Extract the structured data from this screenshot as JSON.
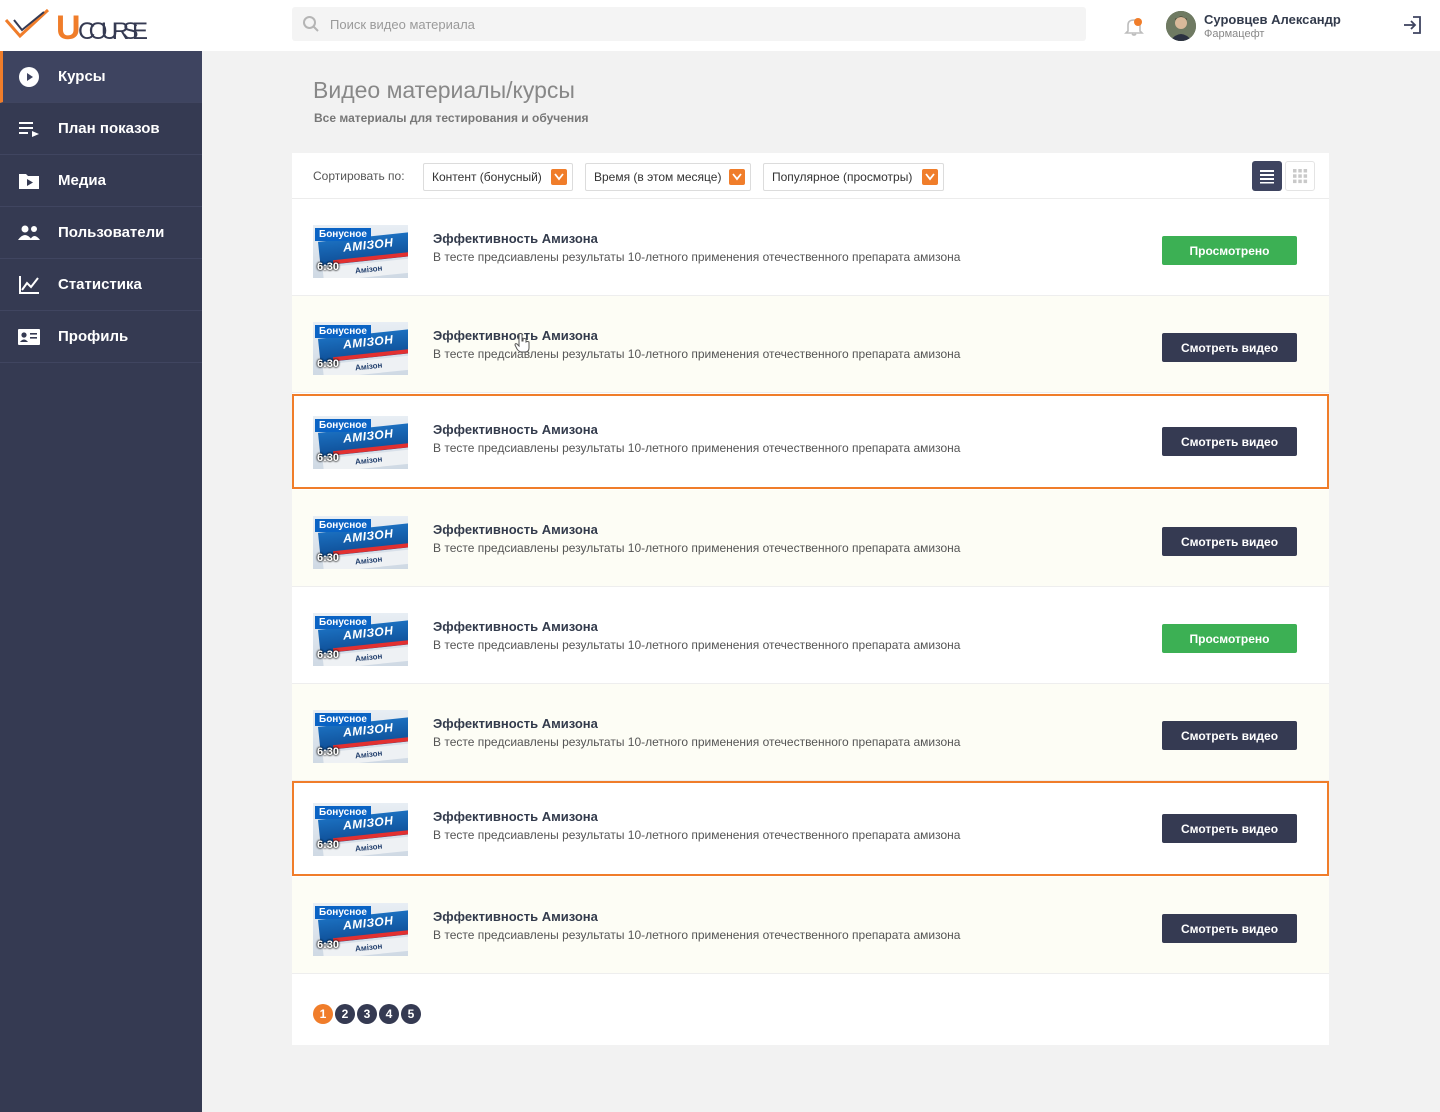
{
  "app": {
    "logo_letter": "U",
    "logo_text": "COURSE"
  },
  "search": {
    "placeholder": "Поиск видео материала"
  },
  "user": {
    "name": "Суровцев Александр",
    "role": "Фармацефт"
  },
  "sidebar": {
    "items": [
      {
        "label": "Курсы",
        "icon": "play-circle-icon",
        "active": true
      },
      {
        "label": "План показов",
        "icon": "playlist-icon",
        "active": false
      },
      {
        "label": "Медиа",
        "icon": "media-folder-icon",
        "active": false
      },
      {
        "label": "Пользователи",
        "icon": "users-icon",
        "active": false
      },
      {
        "label": "Статистика",
        "icon": "chart-icon",
        "active": false
      },
      {
        "label": "Профиль",
        "icon": "profile-card-icon",
        "active": false
      }
    ]
  },
  "page": {
    "title": "Видео материалы/курсы",
    "subtitle": "Все материалы для тестирования и обучения"
  },
  "toolbar": {
    "sort_label": "Сортировать по:",
    "filters": [
      "Контент (бонусный)",
      "Время (в этом месяце)",
      "Популярное (просмотры)"
    ],
    "view_mode": "list"
  },
  "thumbnail": {
    "badge": "Бонусное",
    "duration": "6:30",
    "brand": "АМІЗОН",
    "brand_small": "Амізон"
  },
  "buttons": {
    "watch": "Смотреть видео",
    "viewed": "Просмотрено"
  },
  "rows": [
    {
      "title": "Эффективность Амизона",
      "desc": "В тесте предсиавлены результаты 10-летного применения отечественного препарата амизона",
      "status": "viewed",
      "highlight": false
    },
    {
      "title": "Эффективность Амизона",
      "desc": "В тесте предсиавлены результаты 10-летного применения отечественного препарата амизона",
      "status": "watch",
      "highlight": false
    },
    {
      "title": "Эффективность Амизона",
      "desc": "В тесте предсиавлены результаты 10-летного применения отечественного препарата амизона",
      "status": "watch",
      "highlight": true
    },
    {
      "title": "Эффективность Амизона",
      "desc": "В тесте предсиавлены результаты 10-летного применения отечественного препарата амизона",
      "status": "watch",
      "highlight": false
    },
    {
      "title": "Эффективность Амизона",
      "desc": "В тесте предсиавлены результаты 10-летного применения отечественного препарата амизона",
      "status": "viewed",
      "highlight": false
    },
    {
      "title": "Эффективность Амизона",
      "desc": "В тесте предсиавлены результаты 10-летного применения отечественного препарата амизона",
      "status": "watch",
      "highlight": false
    },
    {
      "title": "Эффективность Амизона",
      "desc": "В тесте предсиавлены результаты 10-летного применения отечественного препарата амизона",
      "status": "watch",
      "highlight": true
    },
    {
      "title": "Эффективность Амизона",
      "desc": "В тесте предсиавлены результаты 10-летного применения отечественного препарата амизона",
      "status": "watch",
      "highlight": false
    }
  ],
  "pagination": {
    "pages": [
      "1",
      "2",
      "3",
      "4",
      "5"
    ],
    "current": "1"
  },
  "colors": {
    "accent": "#f07d2a",
    "sidebar": "#353a52",
    "viewed": "#3cb054",
    "watch": "#353a52"
  }
}
